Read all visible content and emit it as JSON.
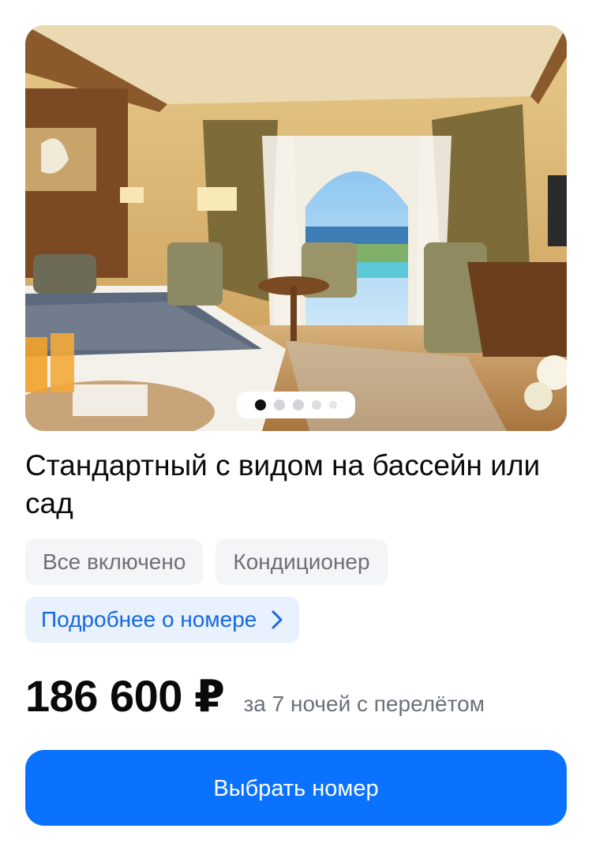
{
  "room": {
    "photo_alt": "Стандартный с видом на бассейн или сад",
    "gallery": {
      "count": 5,
      "active_index": 0
    },
    "title": "Стандартный с видом на бассейн или сад",
    "tags": [
      "Все включено",
      "Кондиционер"
    ],
    "more_link": {
      "label": "Подробнее о номере",
      "icon": "chevron-right-icon"
    }
  },
  "price": {
    "value": "186 600 ₽",
    "note": "за 7 ночей с перелётом"
  },
  "cta": {
    "label": "Выбрать номер"
  },
  "colors": {
    "accent": "#0b72ff",
    "link": "#1668e3",
    "link_bg": "#e8f1fd",
    "tag_bg": "#f4f5f6",
    "muted_text": "#6c7079"
  }
}
